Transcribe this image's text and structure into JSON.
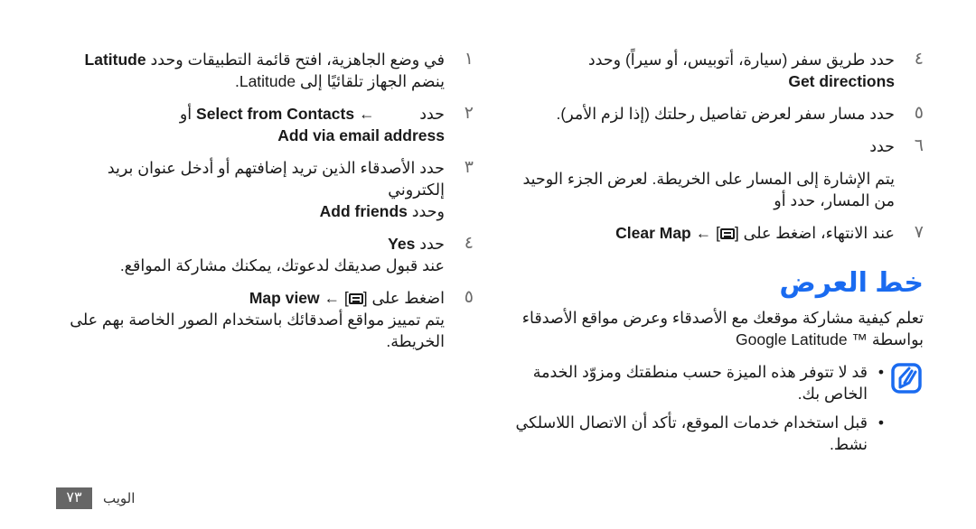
{
  "right_column": {
    "steps": [
      {
        "num": "٤",
        "text": "حدد طريق سفر (سيارة، أتوبيس، أو سيراً) وحدد",
        "bold": "Get directions"
      },
      {
        "num": "٥",
        "text": "حدد مسار سفر لعرض تفاصيل رحلتك (إذا لزم الأمر)."
      },
      {
        "num": "٦",
        "text": "حدد",
        "extra": "يتم الإشارة إلى المسار على الخريطة. لعرض الجزء الوحيد من المسار، حدد       أو"
      },
      {
        "num": "٧",
        "text": "عند الانتهاء، اضغط على",
        "menu_open": "[",
        "menu_close": "]",
        "arrow": "←",
        "bold": "Clear Map"
      }
    ],
    "section_title": "خط العرض",
    "intro_line1": "تعلم كيفية مشاركة موقعك مع الأصدقاء وعرض مواقع الأصدقاء",
    "intro_line2_ar": "بواسطة",
    "intro_line2_en": "Google Latitude ™",
    "note_icon": "note-pencil-icon",
    "notes": [
      "قد لا تتوفر هذه الميزة حسب منطقتك ومزوّد الخدمة الخاص بك.",
      "قبل استخدام خدمات الموقع، تأكد أن الاتصال اللاسلكي نشط."
    ]
  },
  "left_column": {
    "steps": [
      {
        "num": "١",
        "text": "في وضع الجاهزية، افتح قائمة التطبيقات وحدد",
        "bold": "Latitude",
        "sub": "ينضم الجهاز تلقائيًا إلى Latitude."
      },
      {
        "num": "٢",
        "text": "حدد",
        "arrow": "←",
        "bold": "Select from Contacts",
        "or": "أو",
        "bold2": "Add via email address"
      },
      {
        "num": "٣",
        "text": "حدد الأصدقاء الذين تريد إضافتهم أو أدخل عنوان بريد إلكتروني",
        "text2": "وحدد",
        "bold": "Add friends"
      },
      {
        "num": "٤",
        "text": "حدد",
        "bold": "Yes",
        "sub": "عند قبول صديقك لدعوتك، يمكنك مشاركة المواقع."
      },
      {
        "num": "٥",
        "text": "اضغط على",
        "menu_open": "[",
        "menu_close": "]",
        "arrow": "←",
        "bold": "Map view",
        "sub": "يتم تمييز مواقع أصدقائك باستخدام الصور الخاصة بهم على الخريطة."
      }
    ]
  },
  "footer": {
    "page_number": "٧٣",
    "section_label": "الويب"
  },
  "colors": {
    "accent": "#1a6bf0",
    "page_badge": "#666666"
  }
}
